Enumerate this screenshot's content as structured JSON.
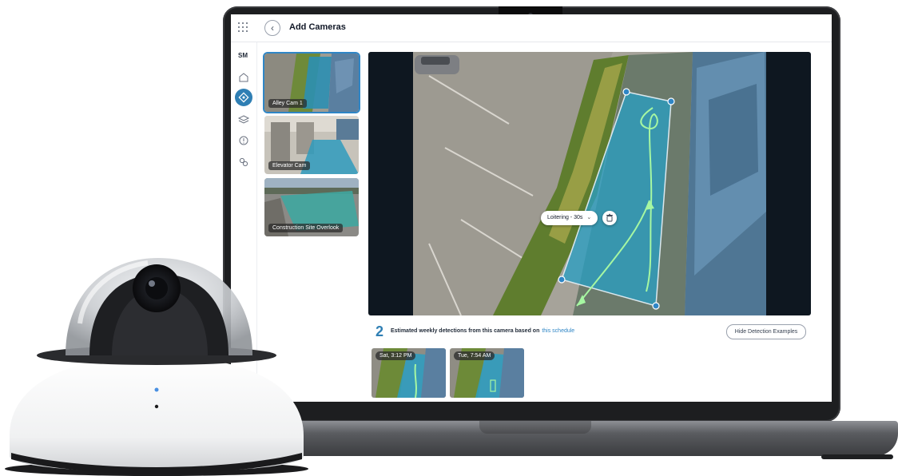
{
  "header": {
    "title": "Add Cameras"
  },
  "sidebar": {
    "user_initials": "SM",
    "items": [
      {
        "icon": "home-icon"
      },
      {
        "icon": "sites-icon",
        "active": true
      },
      {
        "icon": "layers-icon"
      },
      {
        "icon": "alert-icon"
      },
      {
        "icon": "integrations-icon"
      }
    ]
  },
  "cameras": [
    {
      "name": "Alley Cam 1",
      "selected": true
    },
    {
      "name": "Elevator Cam",
      "selected": false
    },
    {
      "name": "Construction Site Overlook",
      "selected": false
    }
  ],
  "zone": {
    "rule_label": "Loitering - 30s"
  },
  "detections": {
    "count": "2",
    "description": "Estimated weekly detections from this camera based on",
    "schedule_link": "this schedule",
    "hide_button": "Hide Detection Examples",
    "examples": [
      {
        "time": "Sat, 3:12 PM"
      },
      {
        "time": "Tue, 7:54 AM"
      }
    ]
  },
  "colors": {
    "accent": "#2f7fb4",
    "zone_fill": "#2a9dc2",
    "path_line": "#a6f7a2"
  }
}
